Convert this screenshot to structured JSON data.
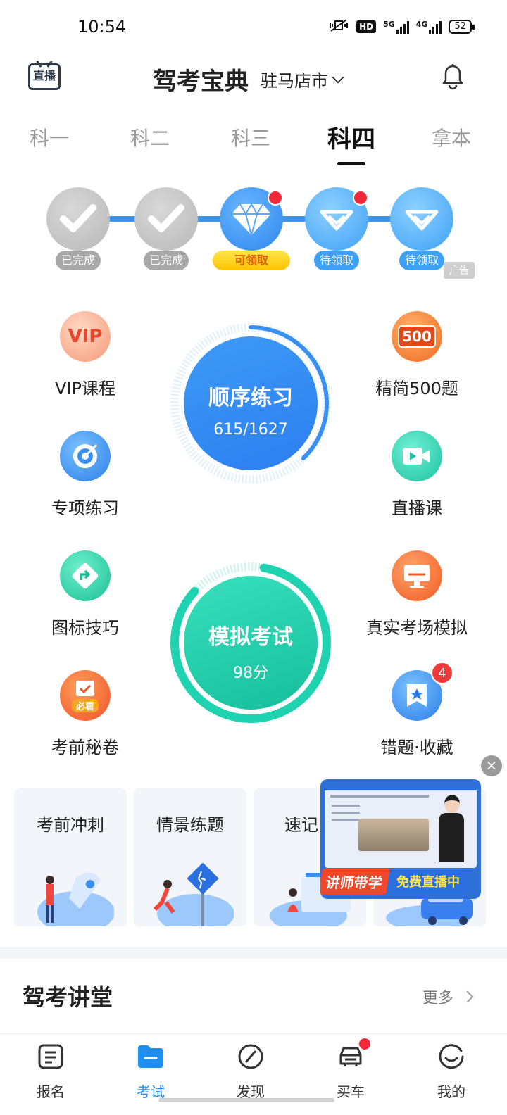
{
  "status_bar": {
    "time": "10:54",
    "network_1": "5G",
    "network_2": "4G",
    "hd": "HD",
    "battery": "52"
  },
  "header": {
    "title": "驾考宝典",
    "city": "驻马店市",
    "live_label": "直播"
  },
  "tabs": [
    {
      "label": "科一",
      "active": false
    },
    {
      "label": "科二",
      "active": false
    },
    {
      "label": "科三",
      "active": false
    },
    {
      "label": "科四",
      "active": true
    },
    {
      "label": "拿本",
      "active": false
    }
  ],
  "progress_nodes": [
    {
      "label": "已完成",
      "state": "done",
      "icon": "check-icon"
    },
    {
      "label": "已完成",
      "state": "done",
      "icon": "check-icon"
    },
    {
      "label": "可领取",
      "state": "claimable",
      "icon": "diamond-icon",
      "dot": true
    },
    {
      "label": "待领取",
      "state": "pending",
      "icon": "diamond-icon",
      "dot": true
    },
    {
      "label": "待领取",
      "state": "pending",
      "icon": "diamond-icon",
      "dot": false
    }
  ],
  "ad_tag": "广告",
  "left_items": [
    {
      "label": "VIP课程",
      "icon": "vip-icon",
      "text": "VIP"
    },
    {
      "label": "专项练习",
      "icon": "target-icon"
    },
    {
      "label": "图标技巧",
      "icon": "sign-arrow-icon"
    },
    {
      "label": "考前秘卷",
      "icon": "exam-paper-icon",
      "text": "必看"
    }
  ],
  "right_items": [
    {
      "label": "精简500题",
      "icon": "500-icon",
      "text": "500"
    },
    {
      "label": "直播课",
      "icon": "video-icon"
    },
    {
      "label": "真实考场模拟",
      "icon": "monitor-icon"
    },
    {
      "label": "错题·收藏",
      "icon": "bookmark-star-icon",
      "badge": "4"
    }
  ],
  "practice": {
    "title": "顺序练习",
    "progress": "615/1627",
    "done": 615,
    "total": 1627,
    "color": "#3a8ff2"
  },
  "mock_exam": {
    "title": "模拟考试",
    "score": "98分",
    "color": "#1fd3b0"
  },
  "cards": [
    {
      "title": "考前冲刺"
    },
    {
      "title": "情景练题"
    },
    {
      "title": "速记口"
    },
    {
      "title": ""
    }
  ],
  "popup": {
    "left_text": "讲师带学",
    "right_text": "免费直播中",
    "close": "×"
  },
  "section": {
    "title": "驾考讲堂",
    "more": "更多"
  },
  "bottom_nav": [
    {
      "label": "报名",
      "icon": "form-icon",
      "active": false
    },
    {
      "label": "考试",
      "icon": "folder-icon",
      "active": true
    },
    {
      "label": "发现",
      "icon": "compass-icon",
      "active": false
    },
    {
      "label": "买车",
      "icon": "car-icon",
      "active": false,
      "dot": true
    },
    {
      "label": "我的",
      "icon": "smile-icon",
      "active": false
    }
  ],
  "colors": {
    "accent": "#1e8ff0",
    "badge_red": "#f2293a",
    "gold": "#ffc300",
    "teal": "#1fd3b0"
  }
}
